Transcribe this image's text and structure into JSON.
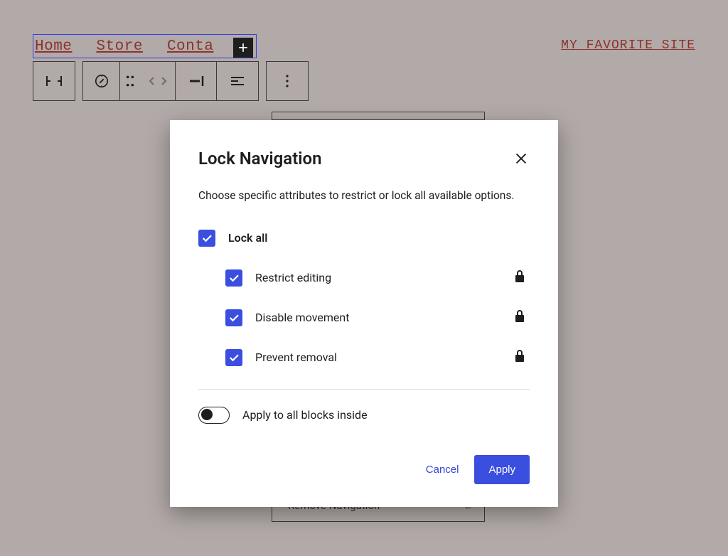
{
  "nav": {
    "links": [
      "Home",
      "Store",
      "Conta"
    ],
    "site_title": "MY FAVORITE SITE"
  },
  "dropdown": {
    "remove_label": "Remove Navigation",
    "remove_shortcut": "⌃Z"
  },
  "modal": {
    "title": "Lock Navigation",
    "description": "Choose specific attributes to restrict or lock all available options.",
    "lock_all": "Lock all",
    "options": [
      {
        "label": "Restrict editing",
        "checked": true
      },
      {
        "label": "Disable movement",
        "checked": true
      },
      {
        "label": "Prevent removal",
        "checked": true
      }
    ],
    "apply_inside": "Apply to all blocks inside",
    "cancel": "Cancel",
    "apply": "Apply"
  },
  "colors": {
    "accent": "#3a4ee0",
    "link": "#8c322c"
  }
}
